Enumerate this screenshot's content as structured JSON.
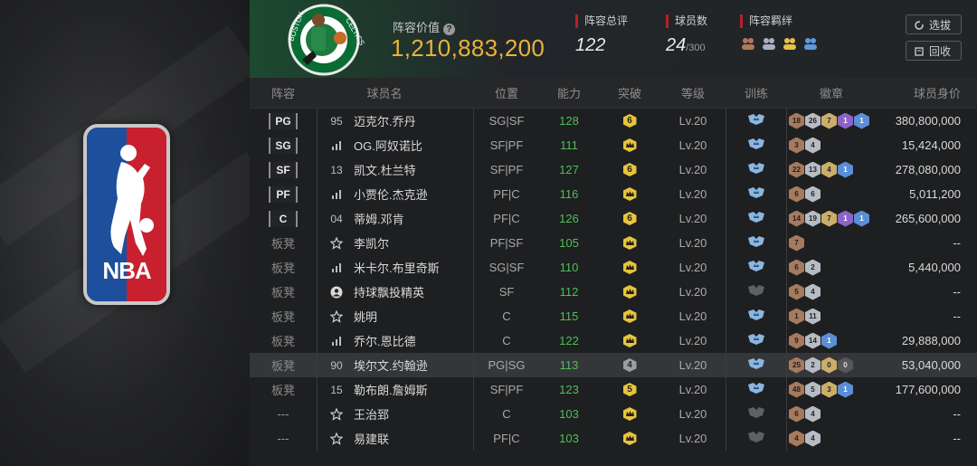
{
  "header": {
    "lineup_value_label": "阵容价值",
    "lineup_value": "1,210,883,200",
    "overall_label": "阵容总评",
    "overall_value": "122",
    "player_count_label": "球员数",
    "player_count": "24",
    "player_max": "/300",
    "bond_label": "阵容羁绊",
    "select_button": "选拔",
    "recycle_button": "回收"
  },
  "columns": [
    "阵容",
    "球员名",
    "位置",
    "能力",
    "突破",
    "等级",
    "训练",
    "徽章",
    "球员身价"
  ],
  "colors": {
    "accent_gold": "#e9b23c",
    "ability_green": "#4fbf5a",
    "marker_red": "#b6202a"
  },
  "rows": [
    {
      "slot": "PG",
      "starter": true,
      "rank": "95",
      "name": "迈克尔.乔丹",
      "role": "SG|SF",
      "ability": "128",
      "breakthrough": "6",
      "level": "Lv.20",
      "badges": [
        {
          "n": "18",
          "t": "bronze"
        },
        {
          "n": "26",
          "t": "silver"
        },
        {
          "n": "7",
          "t": "gold"
        },
        {
          "n": "1",
          "t": "purple"
        },
        {
          "n": "1",
          "t": "blue"
        }
      ],
      "value": "380,800,000"
    },
    {
      "slot": "SG",
      "starter": true,
      "rank": "",
      "name": "OG.阿奴诺比",
      "role": "SF|PF",
      "ability": "111",
      "breakthrough": "crown",
      "level": "Lv.20",
      "badges": [
        {
          "n": "3",
          "t": "bronze"
        },
        {
          "n": "4",
          "t": "silver"
        }
      ],
      "value": "15,424,000"
    },
    {
      "slot": "SF",
      "starter": true,
      "rank": "13",
      "name": "凯文.杜兰特",
      "role": "SF|PF",
      "ability": "127",
      "breakthrough": "6",
      "level": "Lv.20",
      "badges": [
        {
          "n": "22",
          "t": "bronze"
        },
        {
          "n": "13",
          "t": "silver"
        },
        {
          "n": "4",
          "t": "gold"
        },
        {
          "n": "1",
          "t": "blue"
        }
      ],
      "value": "278,080,000"
    },
    {
      "slot": "PF",
      "starter": true,
      "rank": "",
      "name": "小贾伦.杰克逊",
      "role": "PF|C",
      "ability": "116",
      "breakthrough": "crown",
      "level": "Lv.20",
      "badges": [
        {
          "n": "6",
          "t": "bronze"
        },
        {
          "n": "6",
          "t": "silver"
        }
      ],
      "value": "5,011,200"
    },
    {
      "slot": "C",
      "starter": true,
      "rank": "04",
      "name": "蒂姆.邓肯",
      "role": "PF|C",
      "ability": "126",
      "breakthrough": "6",
      "level": "Lv.20",
      "badges": [
        {
          "n": "14",
          "t": "bronze"
        },
        {
          "n": "19",
          "t": "silver"
        },
        {
          "n": "7",
          "t": "gold"
        },
        {
          "n": "1",
          "t": "purple"
        },
        {
          "n": "1",
          "t": "blue"
        }
      ],
      "value": "265,600,000"
    },
    {
      "slot": "板凳",
      "starter": false,
      "rank": "star",
      "name": "李凯尔",
      "role": "PF|SF",
      "ability": "105",
      "breakthrough": "crown",
      "level": "Lv.20",
      "badges": [
        {
          "n": "7",
          "t": "bronze"
        }
      ],
      "value": "--"
    },
    {
      "slot": "板凳",
      "starter": false,
      "rank": "",
      "name": "米卡尔.布里奇斯",
      "role": "SG|SF",
      "ability": "110",
      "breakthrough": "crown",
      "level": "Lv.20",
      "badges": [
        {
          "n": "6",
          "t": "bronze"
        },
        {
          "n": "2",
          "t": "silver"
        }
      ],
      "value": "5,440,000"
    },
    {
      "slot": "板凳",
      "starter": false,
      "rank": "person",
      "name": "持球飘投精英",
      "role": "SF",
      "ability": "112",
      "breakthrough": "crown",
      "level": "Lv.20",
      "train": "gray",
      "badges": [
        {
          "n": "5",
          "t": "bronze"
        },
        {
          "n": "4",
          "t": "silver"
        }
      ],
      "value": "--"
    },
    {
      "slot": "板凳",
      "starter": false,
      "rank": "star",
      "name": "姚明",
      "role": "C",
      "ability": "115",
      "breakthrough": "crown",
      "level": "Lv.20",
      "badges": [
        {
          "n": "1",
          "t": "bronze"
        },
        {
          "n": "11",
          "t": "silver"
        }
      ],
      "value": "--"
    },
    {
      "slot": "板凳",
      "starter": false,
      "rank": "",
      "name": "乔尔.恩比德",
      "role": "C",
      "ability": "122",
      "breakthrough": "crown",
      "level": "Lv.20",
      "badges": [
        {
          "n": "9",
          "t": "bronze"
        },
        {
          "n": "14",
          "t": "silver"
        },
        {
          "n": "1",
          "t": "blue"
        }
      ],
      "value": "29,888,000"
    },
    {
      "slot": "板凳",
      "starter": false,
      "rank": "90",
      "name": "埃尔文.约翰逊",
      "role": "PG|SG",
      "ability": "113",
      "breakthrough": "4",
      "brk_gray": true,
      "level": "Lv.20",
      "highlight": true,
      "badges": [
        {
          "n": "25",
          "t": "bronze"
        },
        {
          "n": "2",
          "t": "silver"
        },
        {
          "n": "0",
          "t": "gold"
        },
        {
          "n": "0",
          "t": "dark"
        }
      ],
      "value": "53,040,000"
    },
    {
      "slot": "板凳",
      "starter": false,
      "rank": "15",
      "name": "勒布朗.詹姆斯",
      "role": "SF|PF",
      "ability": "123",
      "breakthrough": "5",
      "level": "Lv.20",
      "badges": [
        {
          "n": "48",
          "t": "bronze"
        },
        {
          "n": "5",
          "t": "silver"
        },
        {
          "n": "3",
          "t": "gold"
        },
        {
          "n": "1",
          "t": "blue"
        }
      ],
      "value": "177,600,000"
    },
    {
      "slot": "---",
      "starter": false,
      "rank": "star",
      "name": "王治郅",
      "role": "C",
      "ability": "103",
      "breakthrough": "crown",
      "level": "Lv.20",
      "train": "gray",
      "badges": [
        {
          "n": "6",
          "t": "bronze"
        },
        {
          "n": "4",
          "t": "silver"
        }
      ],
      "value": "--"
    },
    {
      "slot": "---",
      "starter": false,
      "rank": "star",
      "name": "易建联",
      "role": "PF|C",
      "ability": "103",
      "breakthrough": "crown",
      "level": "Lv.20",
      "train": "gray",
      "badges": [
        {
          "n": "4",
          "t": "bronze"
        },
        {
          "n": "4",
          "t": "silver"
        }
      ],
      "value": "--"
    }
  ]
}
